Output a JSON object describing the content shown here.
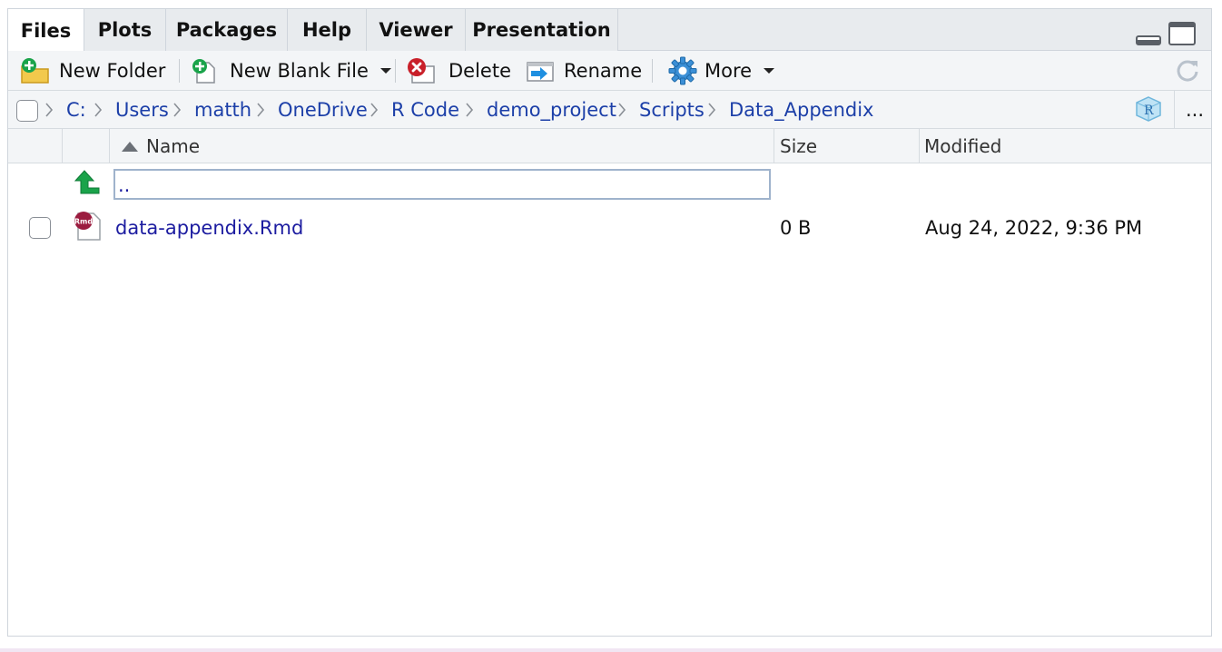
{
  "tabs": [
    {
      "label": "Files",
      "active": true
    },
    {
      "label": "Plots",
      "active": false
    },
    {
      "label": "Packages",
      "active": false
    },
    {
      "label": "Help",
      "active": false
    },
    {
      "label": "Viewer",
      "active": false
    },
    {
      "label": "Presentation",
      "active": false
    }
  ],
  "toolbar": {
    "new_folder": "New Folder",
    "new_blank_file": "New Blank File",
    "delete": "Delete",
    "rename": "Rename",
    "more": "More"
  },
  "breadcrumb": {
    "items": [
      "C:",
      "Users",
      "matth",
      "OneDrive",
      "R Code",
      "demo_project",
      "Scripts",
      "Data_Appendix"
    ],
    "more_label": "..."
  },
  "table": {
    "columns": {
      "name": "Name",
      "size": "Size",
      "modified": "Modified"
    },
    "parent_dir_label": "..",
    "rows": [
      {
        "icon": "rmd-file-icon",
        "icon_label": "Rmd",
        "name": "data-appendix.Rmd",
        "size": "0 B",
        "modified": "Aug 24, 2022, 9:36 PM"
      }
    ]
  },
  "colors": {
    "link": "#1c3fa8",
    "file_link": "#1c1ca0",
    "tab_bar_bg": "#e8ebee",
    "toolbar_bg": "#f3f5f7",
    "green_icon": "#1aa34a",
    "delete_icon": "#c9202a",
    "gear_icon": "#3b8fd6"
  }
}
